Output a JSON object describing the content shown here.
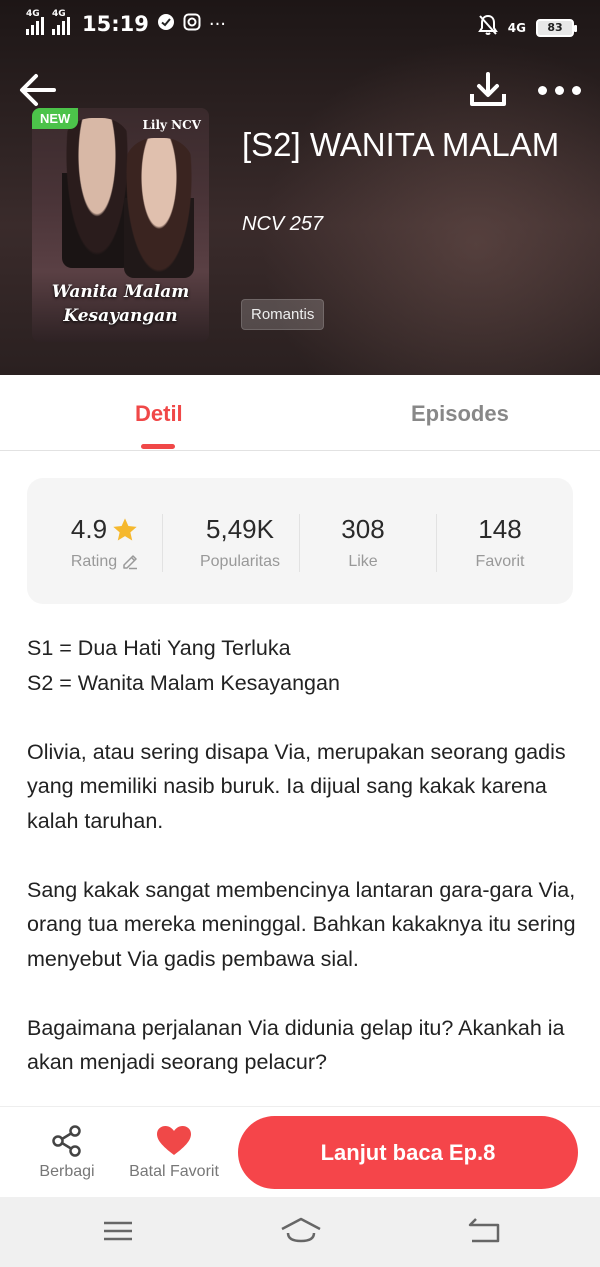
{
  "status_bar": {
    "network1": "4G",
    "network2": "4G",
    "time": "15:19",
    "network3": "4G",
    "battery": "83"
  },
  "header": {
    "cover": {
      "badge": "NEW",
      "author_on_cover": "Lily NCV",
      "title_on_cover_line1": "Wanita Malam",
      "title_on_cover_line2": "Kesayangan"
    },
    "title": "[S2] WANITA MALAM",
    "author": "NCV 257",
    "genre": "Romantis"
  },
  "tabs": [
    {
      "label": "Detil",
      "active": true
    },
    {
      "label": "Episodes",
      "active": false
    }
  ],
  "stats": [
    {
      "value": "4.9",
      "label": "Rating"
    },
    {
      "value": "5,49K",
      "label": "Popularitas"
    },
    {
      "value": "308",
      "label": "Like"
    },
    {
      "value": "148",
      "label": "Favorit"
    }
  ],
  "description": {
    "line1": "S1 = Dua Hati Yang Terluka",
    "line2": "S2 = Wanita Malam Kesayangan",
    "para1": "Olivia, atau sering disapa Via, merupakan seorang gadis yang memiliki nasib buruk. Ia dijual sang kakak karena kalah taruhan.",
    "para2": "Sang kakak sangat membencinya lantaran gara-gara Via, orang tua mereka meninggal. Bahkan kakaknya itu sering menyebut Via gadis pembawa sial.",
    "para3": "Bagaimana perjalanan Via didunia gelap itu? Akankah ia akan menjadi seorang pelacur?"
  },
  "actions": {
    "share_label": "Berbagi",
    "unfavorite_label": "Batal Favorit",
    "continue_label": "Lanjut baca Ep.8"
  },
  "colors": {
    "accent": "#f04848",
    "cta": "#f5454a",
    "star": "#f5b82e",
    "heart": "#f04848",
    "new_badge": "#4cc34a"
  }
}
